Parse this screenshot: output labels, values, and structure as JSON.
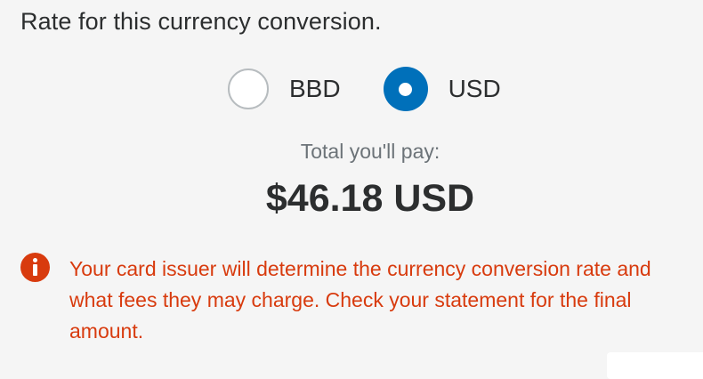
{
  "heading": "Rate for this currency conversion.",
  "currency_options": [
    {
      "label": "BBD",
      "selected": false
    },
    {
      "label": "USD",
      "selected": true
    }
  ],
  "total": {
    "label": "Total you'll pay:",
    "amount": "$46.18 USD"
  },
  "notice": {
    "icon": "info-icon",
    "text": "Your card issuer will determine the currency conversion rate and what fees they may charge. Check your statement for the final amount."
  },
  "colors": {
    "accent": "#0070ba",
    "warning": "#d83b0e",
    "text": "#2c2e2f",
    "muted": "#6c7378",
    "background": "#f5f5f5"
  }
}
